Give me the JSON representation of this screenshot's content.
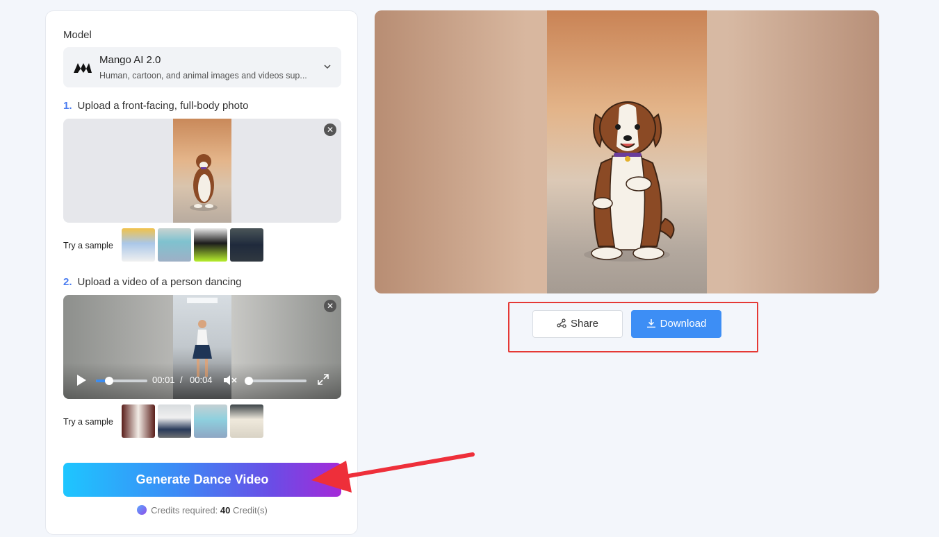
{
  "model": {
    "label": "Model",
    "name": "Mango AI 2.0",
    "description": "Human, cartoon, and animal images and videos sup..."
  },
  "step1": {
    "num": "1.",
    "text": "Upload a front-facing, full-body photo"
  },
  "step2": {
    "num": "2.",
    "text": "Upload a video of a person dancing"
  },
  "sample_label": "Try a sample",
  "close_glyph": "✕",
  "video": {
    "current": "00:01",
    "separator": "/",
    "duration": "00:04",
    "progress": 0.25,
    "volume": 0
  },
  "generate_label": "Generate Dance Video",
  "credits": {
    "prefix": "Credits required:",
    "amount": "40",
    "suffix": "Credit(s)"
  },
  "actions": {
    "share": "Share",
    "download": "Download"
  },
  "colors": {
    "accent": "#3d8ef5",
    "highlight": "#e53935"
  }
}
